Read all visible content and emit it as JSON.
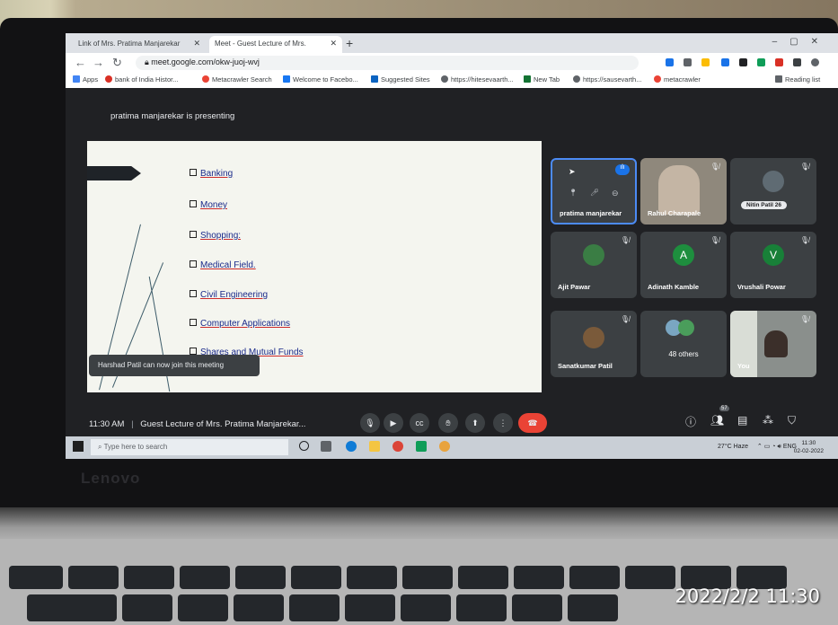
{
  "browser": {
    "tabs": [
      {
        "label": "Link of Mrs. Pratima Manjarekar"
      },
      {
        "label": "Meet - Guest Lecture of Mrs."
      }
    ],
    "url": "meet.google.com/okw-juoj-wvj",
    "bookmarks": [
      {
        "label": "Apps",
        "color": "#4285f4"
      },
      {
        "label": "bank of India Histor...",
        "color": "#d93025"
      },
      {
        "label": "Metacrawler Search",
        "color": "#ea4335"
      },
      {
        "label": "Welcome to Facebo...",
        "color": "#1877f2"
      },
      {
        "label": "Suggested Sites",
        "color": "#0b63c1"
      },
      {
        "label": "https://hitesevaarth...",
        "color": "#5f6368"
      },
      {
        "label": "New Tab",
        "color": "#137333"
      },
      {
        "label": "https://sausevarth...",
        "color": "#5f6368"
      },
      {
        "label": "metacrawler",
        "color": "#ea4335"
      }
    ],
    "reading_list": "Reading list"
  },
  "meet": {
    "presenting": "pratima manjarekar is presenting",
    "slide_items": [
      "Banking",
      "Money",
      "Shopping:",
      "Medical Field.",
      "Civil Engineering",
      "Computer Applications",
      "Shares and Mutual Funds"
    ],
    "toast": "Harshad Patil can now join this meeting",
    "participants": [
      {
        "name": "pratima manjarekar"
      },
      {
        "name": "Rahul Charapale"
      },
      {
        "name": "Nitin Patil 26"
      },
      {
        "name": "Ajit Pawar"
      },
      {
        "name": "Adinath Kamble",
        "initial": "A",
        "color": "#1e8e3e"
      },
      {
        "name": "Vrushali Powar",
        "initial": "V",
        "color": "#188038"
      },
      {
        "name": "Sanatkumar Patil"
      },
      {
        "name": "48 others"
      },
      {
        "name": "You"
      }
    ],
    "time": "11:30 AM",
    "meeting_title": "Guest Lecture of Mrs. Pratima Manjarekar...",
    "people_count": "57"
  },
  "taskbar": {
    "search_placeholder": "Type here to search",
    "weather": "27°C  Haze",
    "lang": "ENG",
    "clock_time": "11:30",
    "clock_date": "02-02-2022"
  },
  "laptop": {
    "brand": "Lenovo"
  },
  "photo": {
    "timestamp": "2022/2/2 11:30"
  }
}
